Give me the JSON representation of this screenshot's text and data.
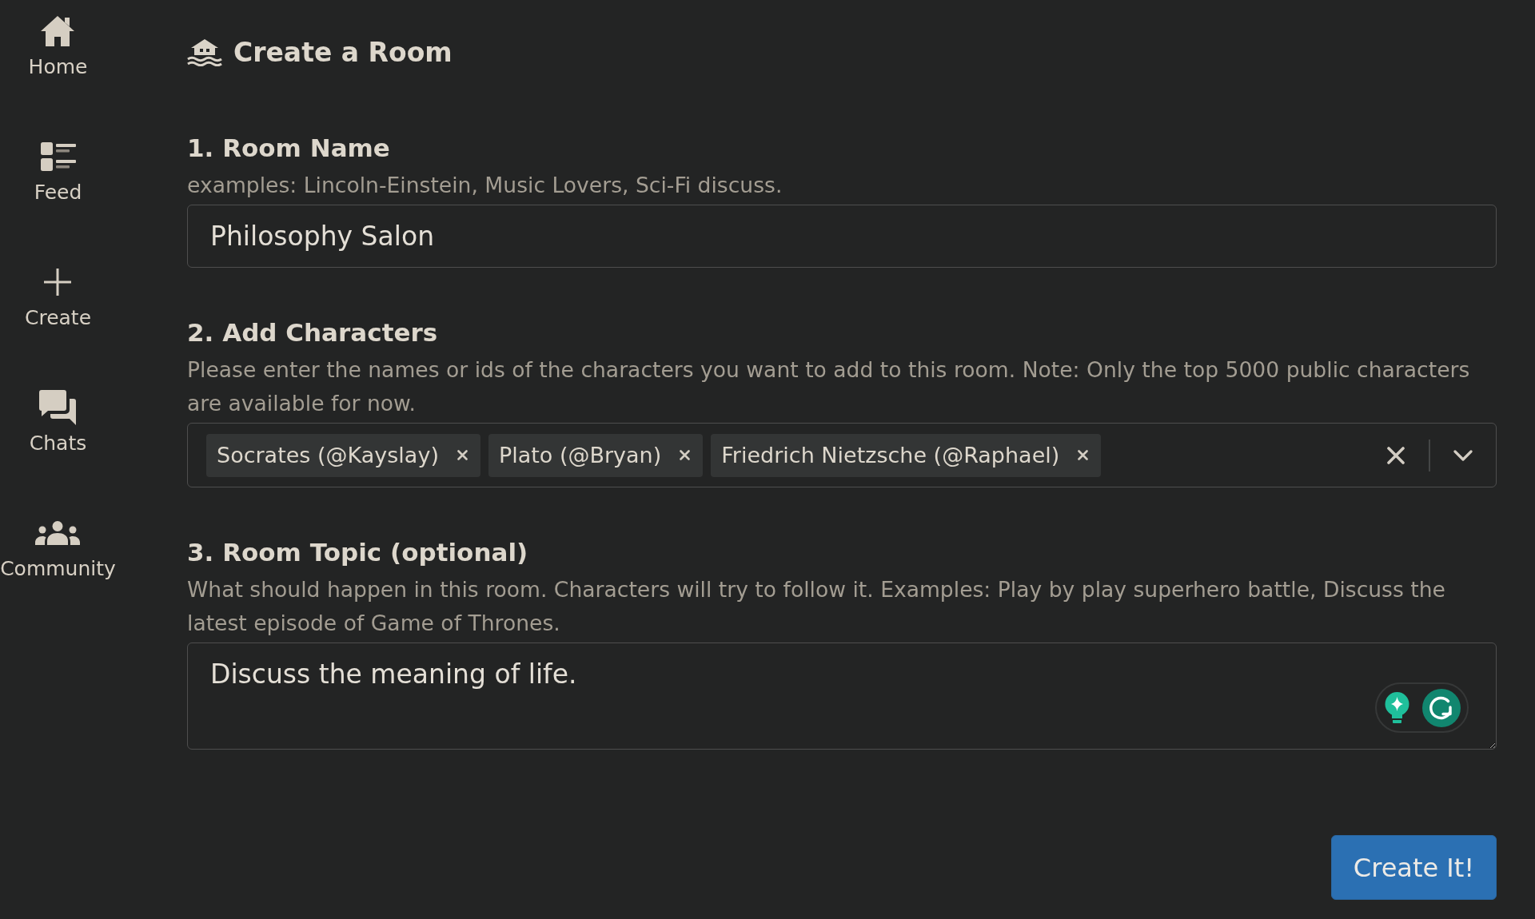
{
  "sidebar": {
    "items": [
      {
        "label": "Home"
      },
      {
        "label": "Feed"
      },
      {
        "label": "Create"
      },
      {
        "label": "Chats"
      },
      {
        "label": "Community"
      }
    ]
  },
  "page": {
    "title": "Create a Room"
  },
  "sections": [
    {
      "kind": "text_input",
      "heading": "1. Room Name",
      "hint": "examples: Lincoln-Einstein, Music Lovers, Sci-Fi discuss.",
      "value": "Philosophy Salon"
    },
    {
      "kind": "tag_select",
      "heading": "2. Add Characters",
      "hint": "Please enter the names or ids of the characters you want to add to this room. Note: Only the top 5000 public characters are available for now.",
      "tags": [
        "Socrates (@Kayslay)",
        "Plato (@Bryan)",
        "Friedrich Nietzsche (@Raphael)"
      ]
    },
    {
      "kind": "textarea",
      "heading": "3. Room Topic (optional)",
      "hint": "What should happen in this room. Characters will try to follow it. Examples: Play by play superhero battle, Discuss the latest episode of Game of Thrones.",
      "value": "Discuss the meaning of life."
    }
  ],
  "submit_button": {
    "label": "Create It!"
  }
}
